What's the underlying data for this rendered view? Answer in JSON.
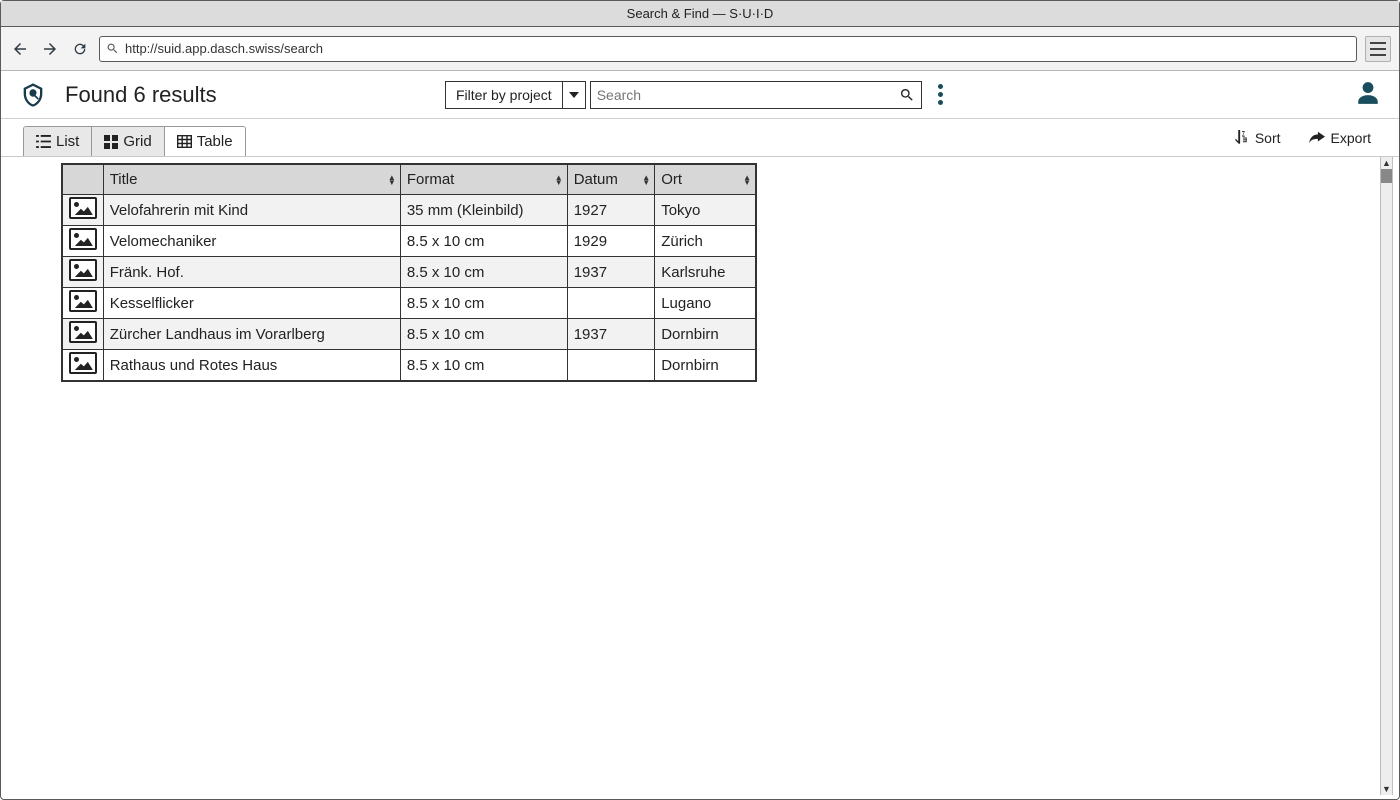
{
  "window": {
    "title": "Search & Find — S·U·I·D"
  },
  "browser": {
    "url": "http://suid.app.dasch.swiss/search"
  },
  "header": {
    "results_title": "Found 6 results",
    "filter_label": "Filter by project",
    "search_placeholder": "Search"
  },
  "view_tabs": {
    "list": "List",
    "grid": "Grid",
    "table": "Table"
  },
  "actions": {
    "sort": "Sort",
    "export": "Export"
  },
  "table": {
    "headers": {
      "title": "Title",
      "format": "Format",
      "datum": "Datum",
      "ort": "Ort"
    },
    "rows": [
      {
        "title": "Velofahrerin mit Kind",
        "format": "35 mm (Kleinbild)",
        "datum": "1927",
        "ort": "Tokyo"
      },
      {
        "title": "Velomechaniker",
        "format": "8.5 x 10 cm",
        "datum": "1929",
        "ort": "Zürich"
      },
      {
        "title": "Fränk. Hof.",
        "format": "8.5 x 10 cm",
        "datum": "1937",
        "ort": "Karlsruhe"
      },
      {
        "title": "Kesselflicker",
        "format": "8.5 x 10 cm",
        "datum": "",
        "ort": "Lugano"
      },
      {
        "title": "Zürcher Landhaus im Vorarlberg",
        "format": "8.5 x 10 cm",
        "datum": "1937",
        "ort": "Dornbirn"
      },
      {
        "title": "Rathaus und Rotes Haus",
        "format": "8.5 x 10 cm",
        "datum": "",
        "ort": "Dornbirn"
      }
    ]
  }
}
